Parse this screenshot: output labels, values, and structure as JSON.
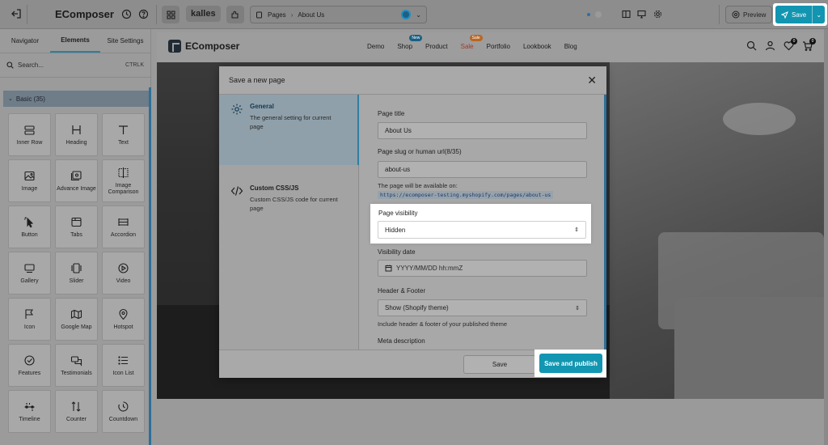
{
  "topbar": {
    "brand": "EComposer",
    "store_logo": "kalles",
    "page_selector": {
      "section": "Pages",
      "page": "About Us"
    },
    "preview_label": "Preview",
    "save_label": "Save"
  },
  "sidebar": {
    "tabs": [
      {
        "label": "Navigator",
        "active": false
      },
      {
        "label": "Elements",
        "active": true
      },
      {
        "label": "Site Settings",
        "active": false
      }
    ],
    "search": {
      "placeholder": "Search...",
      "shortcut": "CTRLK"
    },
    "group": {
      "label": "Basic (35)"
    },
    "elements": [
      {
        "label": "Inner Row",
        "icon": "inner-row-icon"
      },
      {
        "label": "Heading",
        "icon": "heading-icon"
      },
      {
        "label": "Text",
        "icon": "text-icon"
      },
      {
        "label": "Image",
        "icon": "image-icon"
      },
      {
        "label": "Advance Image",
        "icon": "advance-image-icon"
      },
      {
        "label": "Image Comparison",
        "icon": "image-comparison-icon"
      },
      {
        "label": "Button",
        "icon": "button-icon"
      },
      {
        "label": "Tabs",
        "icon": "tabs-icon"
      },
      {
        "label": "Accordion",
        "icon": "accordion-icon"
      },
      {
        "label": "Gallery",
        "icon": "gallery-icon"
      },
      {
        "label": "Slider",
        "icon": "slider-icon"
      },
      {
        "label": "Video",
        "icon": "video-icon"
      },
      {
        "label": "Icon",
        "icon": "flag-icon"
      },
      {
        "label": "Google Map",
        "icon": "map-icon"
      },
      {
        "label": "Hotspot",
        "icon": "hotspot-icon"
      },
      {
        "label": "Features",
        "icon": "features-icon"
      },
      {
        "label": "Testimonials",
        "icon": "testimonials-icon"
      },
      {
        "label": "Icon List",
        "icon": "icon-list-icon"
      },
      {
        "label": "Timeline",
        "icon": "timeline-icon"
      },
      {
        "label": "Counter",
        "icon": "counter-icon"
      },
      {
        "label": "Countdown",
        "icon": "countdown-icon"
      }
    ]
  },
  "store": {
    "logo": "EComposer",
    "nav": [
      {
        "label": "Demo"
      },
      {
        "label": "Shop",
        "badge": "New"
      },
      {
        "label": "Product"
      },
      {
        "label": "Sale",
        "badge": "Sale"
      },
      {
        "label": "Portfolio"
      },
      {
        "label": "Lookbook"
      },
      {
        "label": "Blog"
      }
    ],
    "wishlist_count": "0",
    "cart_count": "0"
  },
  "modal": {
    "title": "Save a new page",
    "tabs": [
      {
        "title": "General",
        "desc": "The general setting for current page"
      },
      {
        "title": "Custom CSS/JS",
        "desc": "Custom CSS/JS code for current page"
      }
    ],
    "fields": {
      "page_title_label": "Page title",
      "page_title_value": "About Us",
      "slug_label": "Page slug or human url(8/35)",
      "slug_value": "about-us",
      "available_note": "The page will be available on:",
      "url": "https://ecomposer-testing.myshopify.com/pages/about-us",
      "visibility_label": "Page visibility",
      "visibility_value": "Hidden",
      "visibility_date_label": "Visibility date",
      "visibility_date_placeholder": "YYYY/MM/DD hh:mmZ",
      "header_footer_label": "Header & Footer",
      "header_footer_value": "Show (Shopify theme)",
      "header_footer_note": "Include header & footer of your published theme",
      "meta_label": "Meta description"
    },
    "save_label": "Save",
    "publish_label": "Save and publish"
  },
  "colors": {
    "accent": "#1296b1",
    "highlight": "#ffffff"
  }
}
